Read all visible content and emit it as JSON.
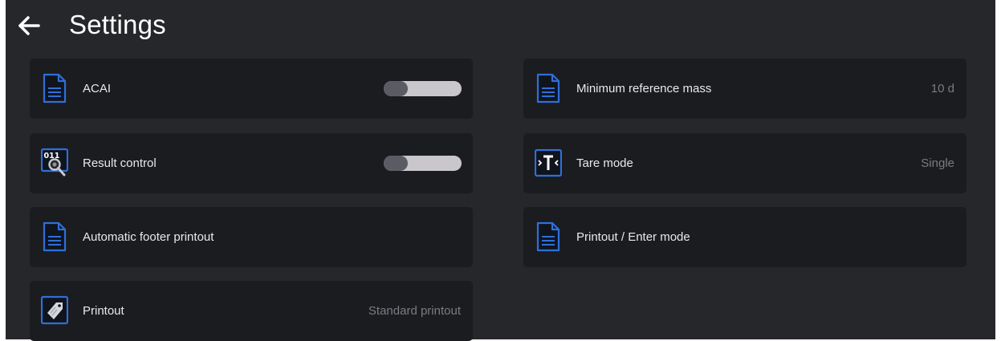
{
  "header": {
    "title": "Settings"
  },
  "settings": {
    "acai": {
      "label": "ACAI",
      "on": false
    },
    "result_control": {
      "label": "Result control",
      "on": false
    },
    "automatic_footer": {
      "label": "Automatic footer printout"
    },
    "printout": {
      "label": "Printout",
      "value": "Standard printout"
    },
    "min_ref_mass": {
      "label": "Minimum reference mass",
      "value": "10 d"
    },
    "tare_mode": {
      "label": "Tare mode",
      "value": "Single"
    },
    "printout_enter": {
      "label": "Printout / Enter mode"
    }
  },
  "colors": {
    "background": "#26272b",
    "tile": "#1b1c1f",
    "accent": "#2f6fd9",
    "text": "#e9e9ec",
    "value_text": "#7b7c82"
  },
  "icons": {
    "back": "arrow-left",
    "document": "document-lines",
    "result_control": "binary-magnifier",
    "tare": "tare-T",
    "printout": "price-tag"
  }
}
